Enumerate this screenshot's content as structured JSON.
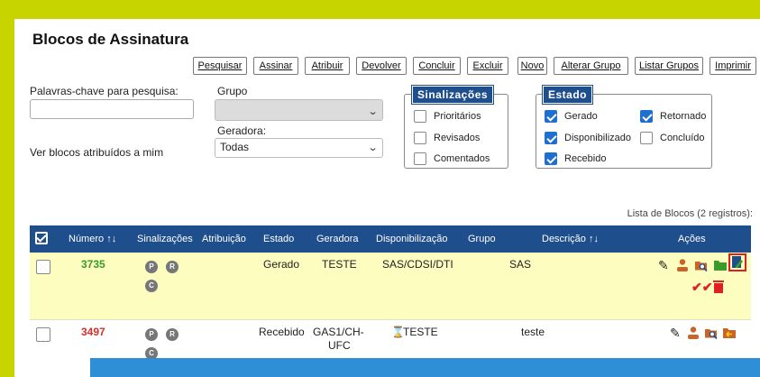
{
  "page": {
    "title": "Blocos de Assinatura"
  },
  "toolbar": {
    "pesquisar": "Pesquisar",
    "assinar": "Assinar",
    "atribuir": "Atribuir",
    "devolver": "Devolver",
    "concluir": "Concluir",
    "excluir": "Excluir",
    "novo": "Novo",
    "alterar_grupo": "Alterar Grupo",
    "listar_grupos": "Listar Grupos",
    "imprimir": "Imprimir"
  },
  "filters": {
    "keywords_label": "Palavras-chave para pesquisa:",
    "keywords_value": "",
    "grupo_label": "Grupo",
    "grupo_value": "",
    "geradora_label": "Geradora:",
    "geradora_value": "Todas",
    "atribuidos_label": "Ver blocos atribuídos a mim"
  },
  "sinalizacoes": {
    "legend": "Sinalizações",
    "items": [
      {
        "label": "Prioritários",
        "checked": false
      },
      {
        "label": "Revisados",
        "checked": false
      },
      {
        "label": "Comentados",
        "checked": false
      }
    ]
  },
  "estado": {
    "legend": "Estado",
    "items": [
      {
        "label": "Gerado",
        "checked": true
      },
      {
        "label": "Retornado",
        "checked": true
      },
      {
        "label": "Disponibilizado",
        "checked": true
      },
      {
        "label": "Concluído",
        "checked": false
      },
      {
        "label": "Recebido",
        "checked": true
      }
    ]
  },
  "table": {
    "caption": "Lista de Blocos (2 registros):",
    "headers": {
      "numero": "Número",
      "sinalizacoes": "Sinalizações",
      "atribuicao": "Atribuição",
      "estado": "Estado",
      "geradora": "Geradora",
      "disponibilizacao": "Disponibilização",
      "grupo": "Grupo",
      "descricao": "Descrição",
      "acoes": "Ações"
    },
    "sort_icon": "↑↓",
    "rows": [
      {
        "numero": "3735",
        "numero_color": "#3a9a2a",
        "flags": [
          "P",
          "R",
          "C"
        ],
        "atribuicao": "",
        "estado": "Gerado",
        "geradora": "TESTE",
        "disponibilizacao": "SAS/CDSI/DTI",
        "grupo": "",
        "descricao": "SAS",
        "actions": [
          "pen-icon",
          "user-icon",
          "search-folder-icon",
          "folder-icon",
          "edit-doc-icon",
          "check-icon",
          "trash-icon"
        ]
      },
      {
        "numero": "3497",
        "numero_color": "#d0312d",
        "flags": [
          "P",
          "R",
          "C"
        ],
        "atribuicao": "",
        "estado": "Recebido",
        "geradora_line1": "GAS1/CH-",
        "geradora_line2": "UFC",
        "disponibilizacao": "TESTE",
        "grupo": "",
        "descricao": "teste",
        "actions": [
          "hourglass-icon",
          "pen-icon",
          "user-icon",
          "search-folder-icon",
          "return-folder-icon"
        ]
      }
    ]
  },
  "colors": {
    "accent": "#1f4e8c",
    "frame": "#c8d400",
    "checkbox_on": "#1f6fd0",
    "bottom_bar": "#2e8fd6"
  }
}
